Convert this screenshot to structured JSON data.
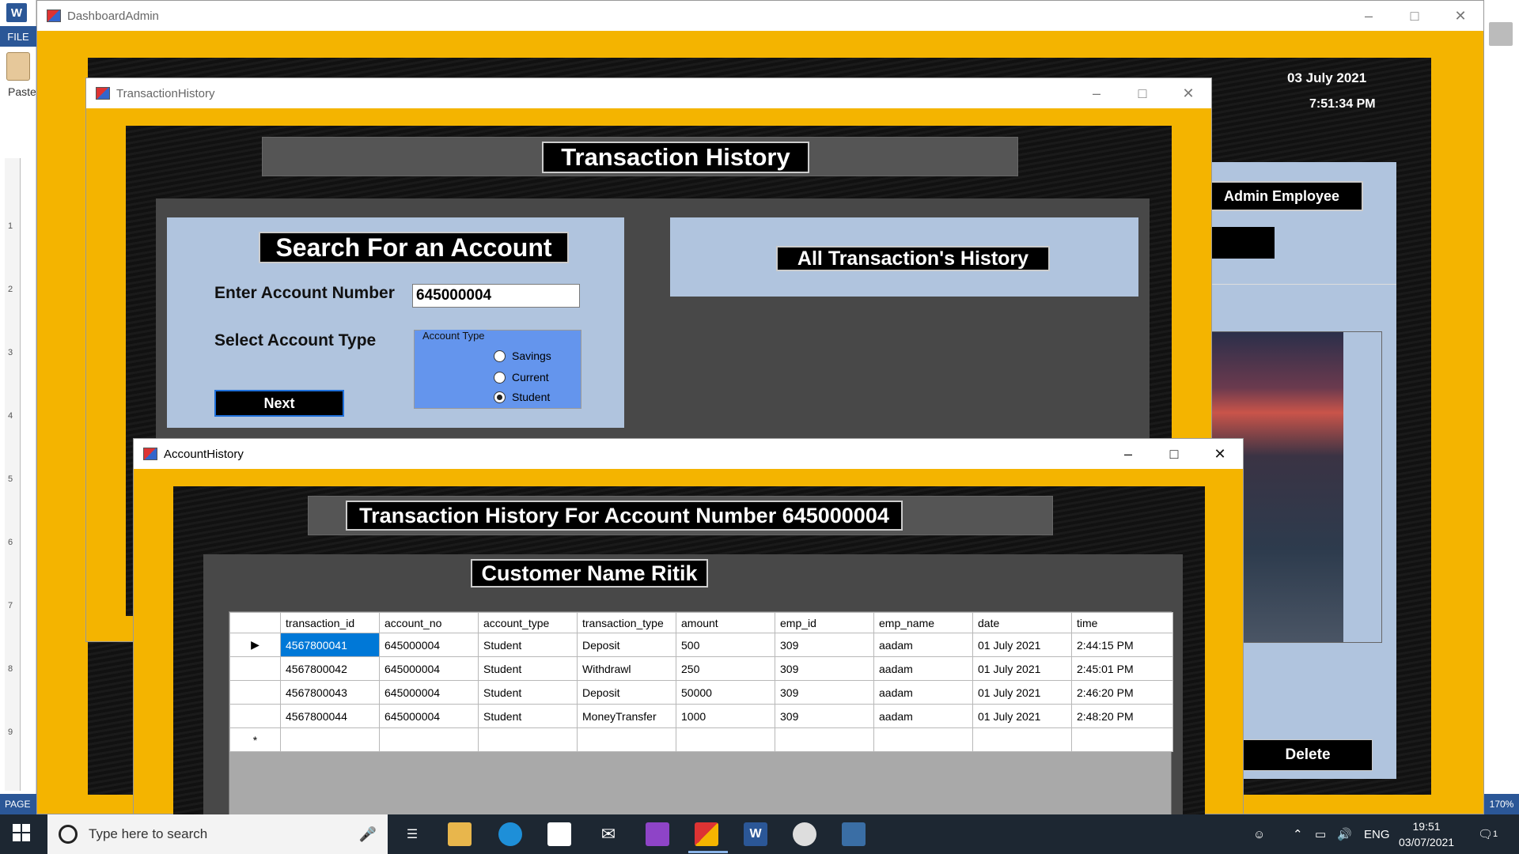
{
  "word": {
    "file_tab": "FILE",
    "paste_label": "Paste",
    "page_label": "PAGE",
    "zoom": "170%",
    "ruler": [
      "1",
      "2",
      "3",
      "4",
      "5",
      "6",
      "7",
      "8",
      "9"
    ]
  },
  "dashboard": {
    "title": "DashboardAdmin",
    "date": "03 July 2021",
    "time": "7:51:34 PM",
    "admin_label": "Admin Employee",
    "delete_label": "Delete"
  },
  "transaction_history": {
    "title": "TransactionHistory",
    "header": "Transaction History",
    "search_title": "Search For an Account",
    "account_number_label": "Enter Account Number",
    "account_number_value": "645000004",
    "account_type_label": "Select Account Type",
    "group_title": "Account Type",
    "options": [
      {
        "label": "Savings",
        "checked": false
      },
      {
        "label": "Current",
        "checked": false
      },
      {
        "label": "Student",
        "checked": true
      }
    ],
    "next_label": "Next",
    "all_history_label": "All Transaction's History"
  },
  "account_history": {
    "title": "AccountHistory",
    "header": "Transaction History For Account Number 645000004",
    "customer": "Customer Name Ritik",
    "columns": [
      "transaction_id",
      "account_no",
      "account_type",
      "transaction_type",
      "amount",
      "emp_id",
      "emp_name",
      "date",
      "time"
    ],
    "rows": [
      [
        "4567800041",
        "645000004",
        "Student",
        "Deposit",
        "500",
        "309",
        "aadam",
        "01 July 2021",
        "2:44:15 PM"
      ],
      [
        "4567800042",
        "645000004",
        "Student",
        "Withdrawl",
        "250",
        "309",
        "aadam",
        "01 July 2021",
        "2:45:01 PM"
      ],
      [
        "4567800043",
        "645000004",
        "Student",
        "Deposit",
        "50000",
        "309",
        "aadam",
        "01 July 2021",
        "2:46:20 PM"
      ],
      [
        "4567800044",
        "645000004",
        "Student",
        "MoneyTransfer",
        "1000",
        "309",
        "aadam",
        "01 July 2021",
        "2:48:20 PM"
      ]
    ],
    "current_row_marker": "▶",
    "new_row_marker": "*"
  },
  "taskbar": {
    "search_placeholder": "Type here to search",
    "lang": "ENG",
    "clock_time": "19:51",
    "clock_date": "03/07/2021",
    "notification_count": "1",
    "apps": [
      "task-view-icon",
      "file-explorer-icon",
      "edge-icon",
      "store-icon",
      "mail-icon",
      "visual-studio-icon",
      "winforms-app-icon",
      "word-icon",
      "paint-icon",
      "sql-icon"
    ]
  }
}
